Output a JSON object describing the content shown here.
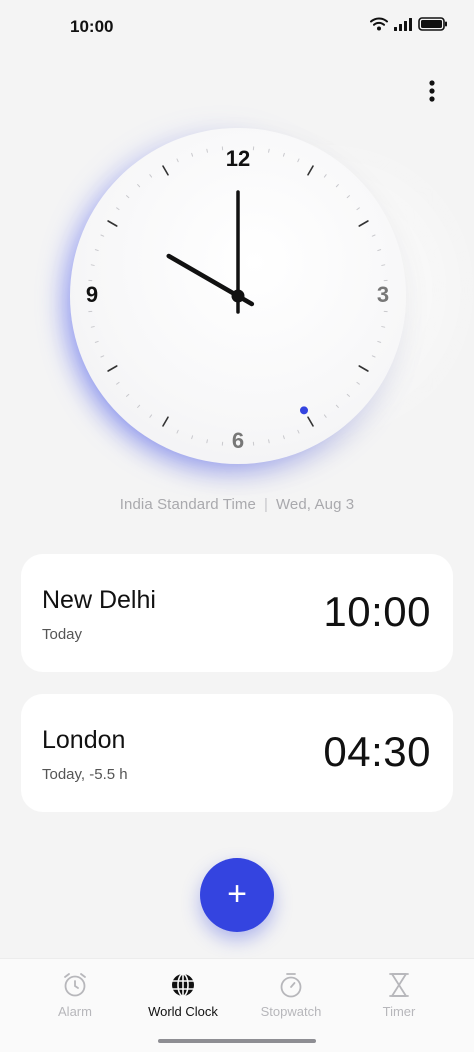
{
  "status_bar": {
    "time": "10:00",
    "icons": [
      "wifi-icon",
      "signal-icon",
      "battery-icon"
    ]
  },
  "menu": {
    "icon": "more-vertical-icon"
  },
  "clock": {
    "numerals": {
      "twelve": "12",
      "three": "3",
      "six": "6",
      "nine": "9"
    },
    "hour": 10,
    "minute": 0,
    "second_indicator_seconds": 25,
    "accent_color": "#3444e0"
  },
  "timezone": {
    "zone": "India Standard Time",
    "separator": "|",
    "date": "Wed, Aug 3"
  },
  "cities": [
    {
      "name": "New Delhi",
      "sub": "Today",
      "time": "10:00"
    },
    {
      "name": "London",
      "sub": "Today,  -5.5 h",
      "time": "04:30"
    }
  ],
  "fab": {
    "label": "+",
    "icon": "plus-icon"
  },
  "nav": {
    "items": [
      {
        "label": "Alarm",
        "icon": "alarm-icon",
        "active": false
      },
      {
        "label": "World Clock",
        "icon": "globe-icon",
        "active": true
      },
      {
        "label": "Stopwatch",
        "icon": "stopwatch-icon",
        "active": false
      },
      {
        "label": "Timer",
        "icon": "hourglass-icon",
        "active": false
      }
    ]
  }
}
